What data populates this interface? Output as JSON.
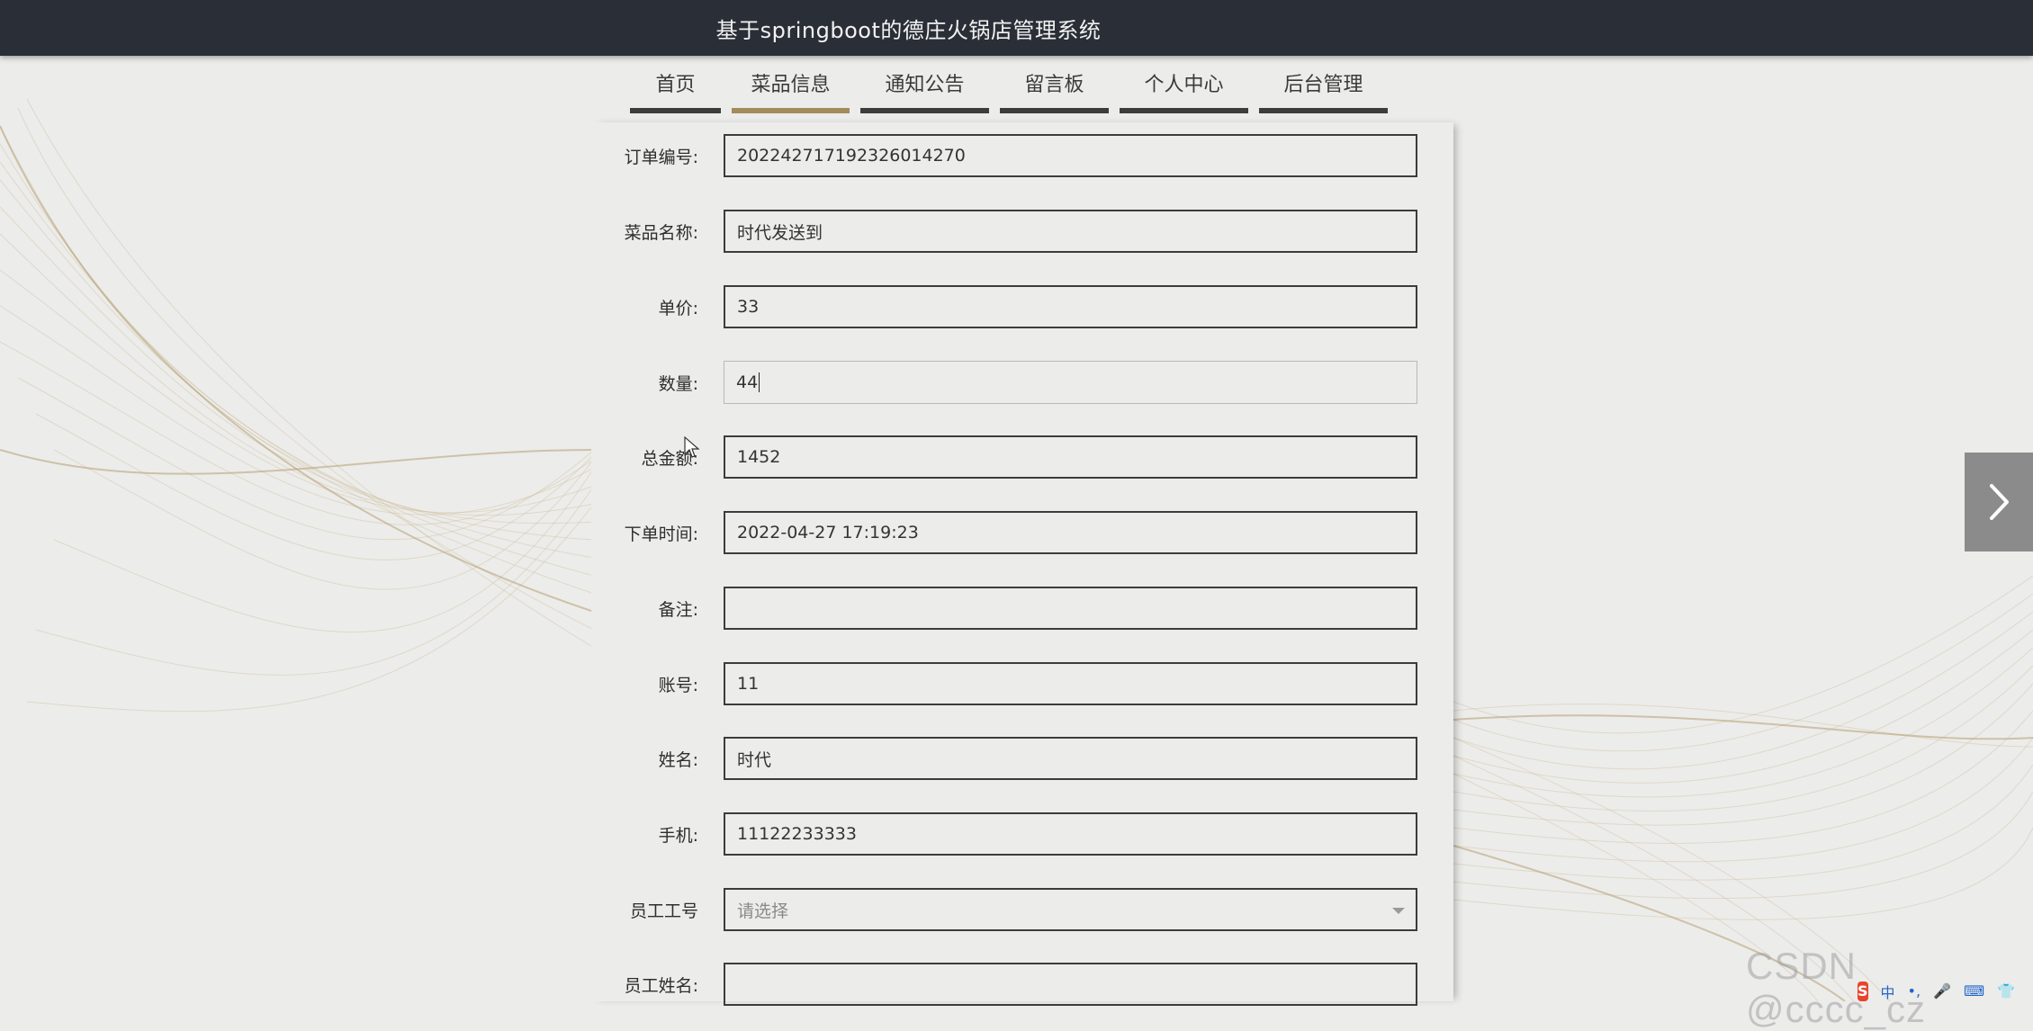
{
  "header": {
    "title": "基于springboot的德庄火锅店管理系统"
  },
  "nav": {
    "items": [
      {
        "label": "首页"
      },
      {
        "label": "菜品信息"
      },
      {
        "label": "通知公告"
      },
      {
        "label": "留言板"
      },
      {
        "label": "个人中心"
      },
      {
        "label": "后台管理"
      }
    ],
    "active_index": 1
  },
  "form": {
    "order_no": {
      "label": "订单编号:",
      "value": "202242717192326014270"
    },
    "dish_name": {
      "label": "菜品名称:",
      "value": "时代发送到"
    },
    "unit_price": {
      "label": "单价:",
      "value": "33"
    },
    "quantity": {
      "label": "数量:",
      "value": "44"
    },
    "total": {
      "label": "总金额:",
      "value": "1452"
    },
    "order_time": {
      "label": "下单时间:",
      "value": "2022-04-27 17:19:23"
    },
    "remark": {
      "label": "备注:",
      "value": ""
    },
    "account": {
      "label": "账号:",
      "value": "11"
    },
    "name": {
      "label": "姓名:",
      "value": "时代"
    },
    "phone": {
      "label": "手机:",
      "value": "11122233333"
    },
    "staff_no": {
      "label": "员工工号",
      "placeholder": "请选择"
    },
    "staff_name": {
      "label": "员工姓名:",
      "value": ""
    }
  },
  "watermark": "CSDN @cccc_cz",
  "ime": {
    "logo": "S",
    "items": [
      "中",
      "•,",
      "🎤",
      "⌨",
      "👕",
      "⋮"
    ]
  },
  "colors": {
    "title_bar": "#2a2f37",
    "nav_active": "#a38b5c",
    "nav_inactive": "#3d3d3d",
    "next_button": "#8b8b8b"
  },
  "icons": {
    "next": "chevron-right-icon",
    "select": "caret-down-icon",
    "pointer": "mouse-pointer-icon"
  }
}
